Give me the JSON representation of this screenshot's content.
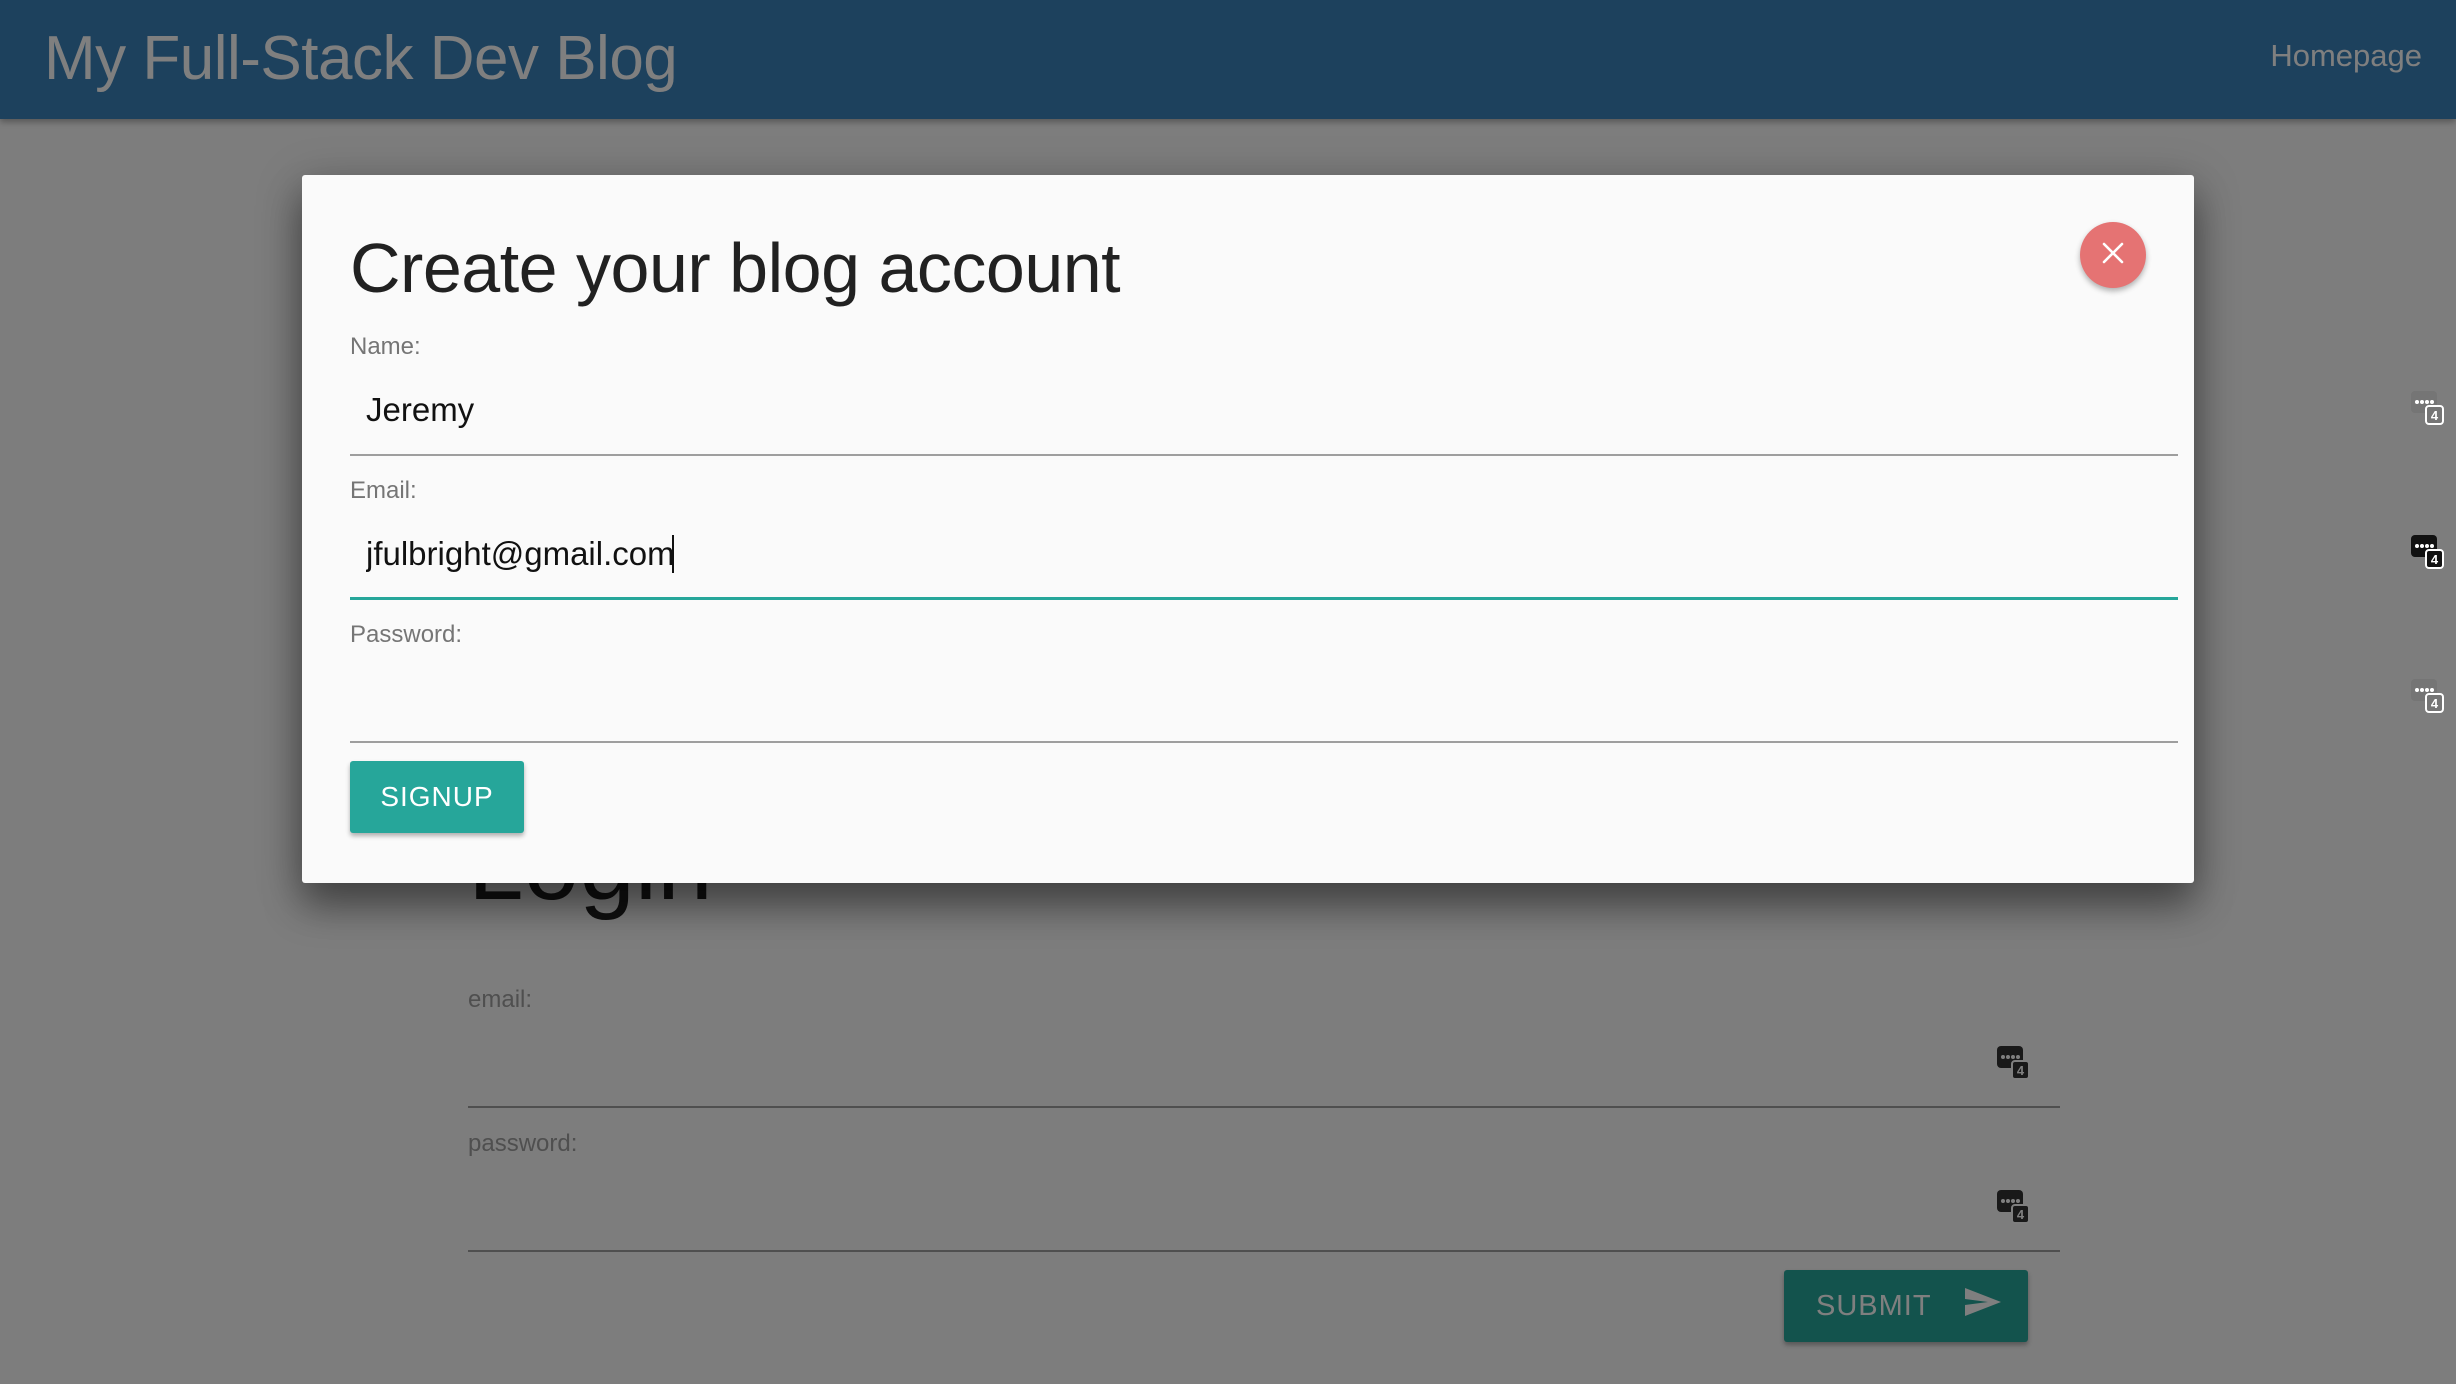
{
  "navbar": {
    "brand": "My Full-Stack Dev Blog",
    "homepage_link": "Homepage"
  },
  "login": {
    "title": "Login",
    "email_label": "email:",
    "password_label": "password:",
    "submit_label": "SUBMIT"
  },
  "modal": {
    "title": "Create your blog account",
    "name_label": "Name:",
    "name_value": "Jeremy",
    "email_label": "Email:",
    "email_value": "jfulbright@gmail.com",
    "password_label": "Password:",
    "password_value": "",
    "signup_label": "SIGNUP",
    "close_icon": "close-icon"
  },
  "colors": {
    "navbar": "#3b82ba",
    "accent": "#26a69a",
    "close_button": "#e57373",
    "overlay": "rgba(0,0,0,0.5)"
  },
  "icons": {
    "password_manager": "password-manager-icon",
    "send": "send-icon"
  }
}
